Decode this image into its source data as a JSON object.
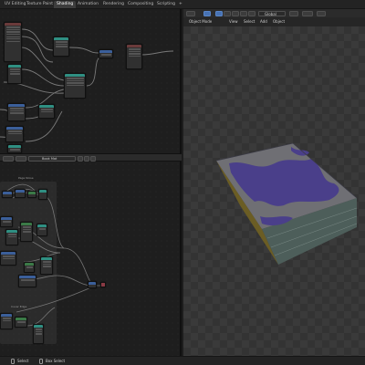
{
  "topbar": {
    "tabs": [
      {
        "label": "UV Editing",
        "active": false
      },
      {
        "label": "Texture Paint",
        "active": false
      },
      {
        "label": "Shading",
        "active": true
      },
      {
        "label": "Animation",
        "active": false
      },
      {
        "label": "Rendering",
        "active": false
      },
      {
        "label": "Compositing",
        "active": false
      },
      {
        "label": "Scripting",
        "active": false
      }
    ],
    "add_label": "+"
  },
  "node_editor_header": {
    "material_name": "Book Mat"
  },
  "viewport_header": {
    "transform_orientation": "Global"
  },
  "viewport_menu": {
    "mode": "Object Mode",
    "items": [
      "View",
      "Select",
      "Add",
      "Object"
    ]
  },
  "node_frames": {
    "upper_label": "Page Noise",
    "lower_label": "Cover Edge"
  },
  "statusbar": {
    "select_label": "Select",
    "box_select_label": "Box Select"
  },
  "colors": {
    "cover_purple": "#4a3f8a",
    "cover_grey": "#6f6f74",
    "pages": "#4d5e5a",
    "spine_yellow": "#8a7a2e",
    "header_teal": "#2f8f82",
    "header_green": "#3b7a47",
    "header_blue": "#3b5f9a",
    "selection_blue": "#4772b3"
  },
  "icons": [
    "cursor-icon",
    "select-box-icon",
    "move-icon",
    "viewport-shading-icon",
    "magnet-icon",
    "proportional-edit-icon",
    "global-orientation-icon",
    "pivot-icon",
    "mouse-left-icon",
    "mouse-right-icon"
  ]
}
